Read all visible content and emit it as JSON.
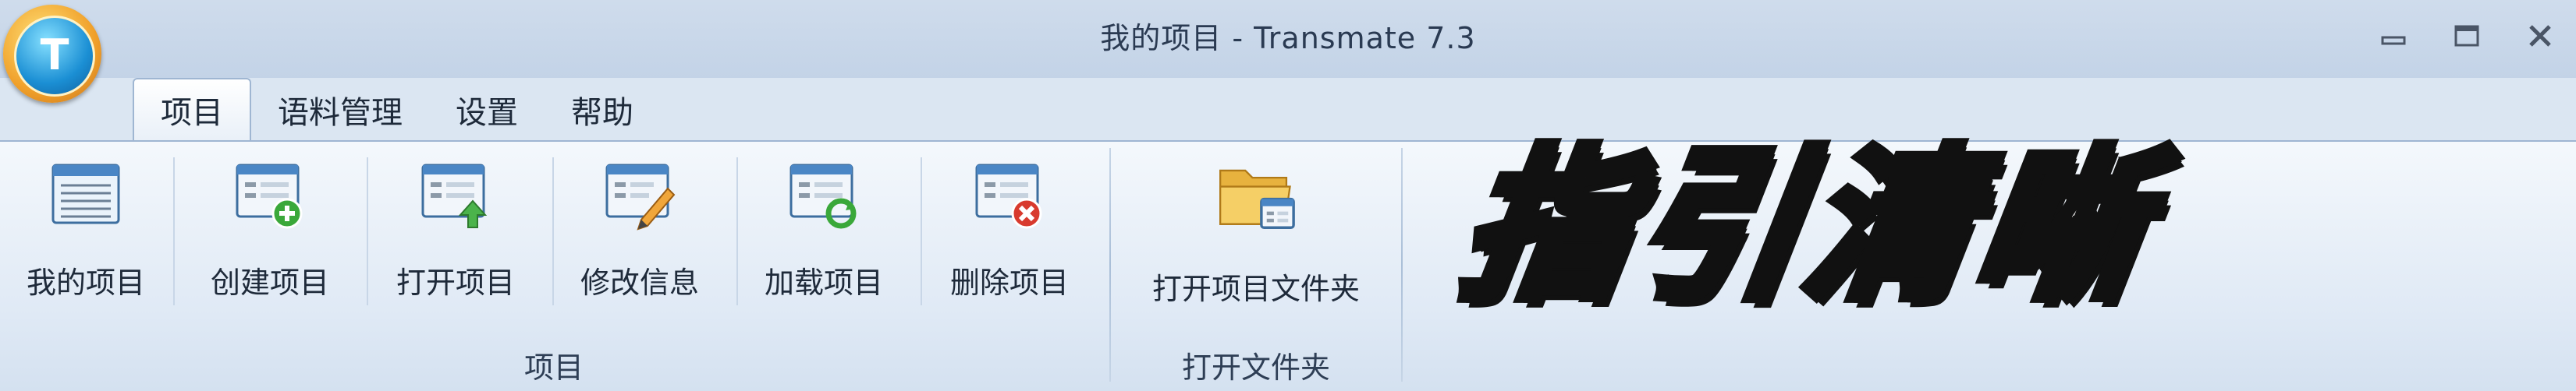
{
  "window": {
    "title": "我的项目 - Transmate 7.3"
  },
  "app_logo": {
    "letter": "T"
  },
  "tabs": [
    {
      "label": "项目",
      "active": true
    },
    {
      "label": "语料管理",
      "active": false
    },
    {
      "label": "设置",
      "active": false
    },
    {
      "label": "帮助",
      "active": false
    }
  ],
  "ribbon": {
    "groups": [
      {
        "label": "项目",
        "buttons": [
          {
            "label": "我的项目",
            "icon": "list-window-icon"
          },
          {
            "label": "创建项目",
            "icon": "window-plus-icon"
          },
          {
            "label": "打开项目",
            "icon": "window-open-icon"
          },
          {
            "label": "修改信息",
            "icon": "window-edit-icon"
          },
          {
            "label": "加载项目",
            "icon": "window-load-icon"
          },
          {
            "label": "删除项目",
            "icon": "window-delete-icon"
          }
        ]
      },
      {
        "label": "打开文件夹",
        "buttons": [
          {
            "label": "打开项目文件夹",
            "icon": "folder-icon"
          }
        ]
      }
    ]
  },
  "overlay_text": "指引清晰",
  "colors": {
    "titlebar": "#c9d8ea",
    "ribbon": "#e6eef8",
    "plus": "#3aa83a",
    "delete": "#d83a2e",
    "folder": "#f2c453"
  }
}
